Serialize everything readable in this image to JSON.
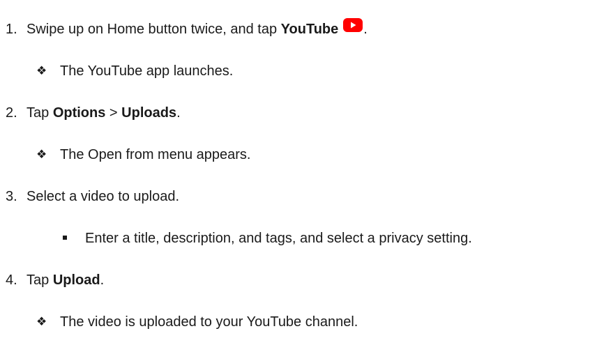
{
  "steps": [
    {
      "number": "1.",
      "text_before": "Swipe up on Home button twice, and tap ",
      "bold": "YouTube",
      "icon": "youtube-app-icon",
      "text_after": "."
    },
    {
      "result": "The YouTube app launches."
    },
    {
      "number": "2.",
      "text_before": "Tap ",
      "bold1": "Options",
      "separator": " > ",
      "bold2": "Uploads",
      "text_after": "."
    },
    {
      "result": "The Open from menu appears."
    },
    {
      "number": "3.",
      "text": "Select a video to upload."
    },
    {
      "sub": "Enter a title, description, and tags, and select a privacy setting."
    },
    {
      "number": "4.",
      "text_before": "Tap ",
      "bold": "Upload",
      "text_after": "."
    },
    {
      "result": "The video is uploaded to your YouTube channel."
    }
  ],
  "glyphs": {
    "diamond": "❖"
  },
  "colors": {
    "youtube_red": "#ff0000"
  }
}
